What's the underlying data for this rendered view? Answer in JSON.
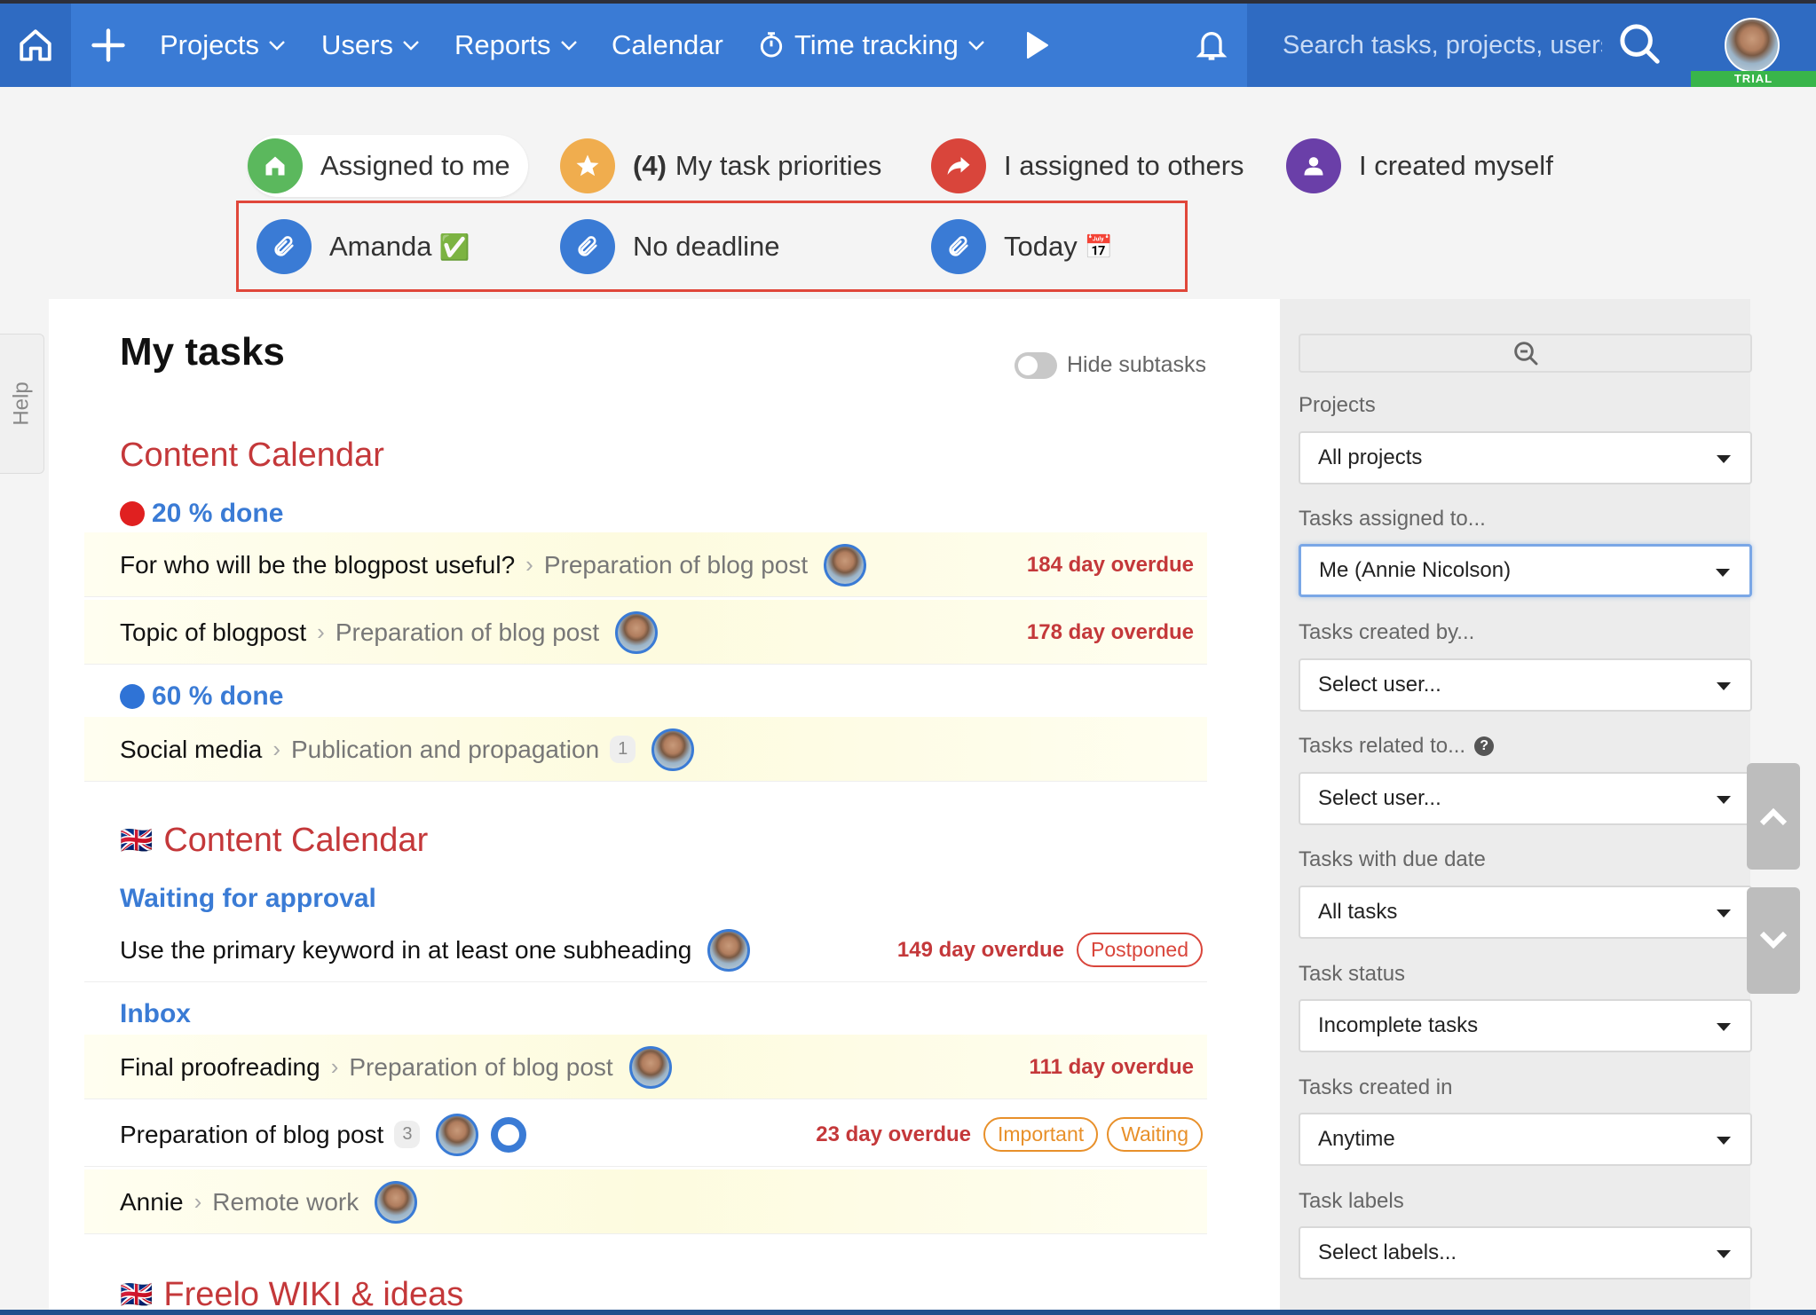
{
  "nav": {
    "projects": "Projects",
    "users": "Users",
    "reports": "Reports",
    "calendar": "Calendar",
    "time_tracking": "Time tracking",
    "search_placeholder": "Search tasks, projects, users",
    "trial": "TRIAL"
  },
  "filters": {
    "assigned_to_me": "Assigned to me",
    "priorities_count": "(4)",
    "priorities": "My task priorities",
    "assigned_to_others": "I assigned to others",
    "created_myself": "I created myself"
  },
  "saved_filters": [
    {
      "label": "Amanda",
      "emoji": "✅"
    },
    {
      "label": "No deadline",
      "emoji": ""
    },
    {
      "label": "Today",
      "emoji": "📅"
    }
  ],
  "help": "Help",
  "main": {
    "title": "My tasks",
    "hide_subtasks": "Hide subtasks",
    "projects": [
      {
        "name": "Content Calendar",
        "lists": [
          {
            "name": "20 % done",
            "dot": "#e02020",
            "tasks": [
              {
                "name": "For who will be the blogpost useful?",
                "parent": "Preparation of blog post",
                "overdue": "184 day overdue"
              },
              {
                "name": "Topic of blogpost",
                "parent": "Preparation of blog post",
                "overdue": "178 day overdue"
              }
            ]
          },
          {
            "name": "60 % done",
            "dot": "#2f73d6",
            "tasks": [
              {
                "name": "Social media",
                "parent": "Publication and propagation",
                "count": "1"
              }
            ]
          }
        ]
      },
      {
        "name": "Content Calendar",
        "flag": "🇬🇧",
        "lists": [
          {
            "name": "Waiting for approval",
            "tasks": [
              {
                "name": "Use the primary keyword in at least one subheading",
                "overdue": "149 day overdue",
                "label": "Postponed"
              }
            ]
          },
          {
            "name": "Inbox",
            "tasks": [
              {
                "name": "Final proofreading",
                "parent": "Preparation of blog post",
                "overdue": "111 day overdue"
              },
              {
                "name": "Preparation of blog post",
                "count": "3",
                "overdue": "23 day overdue",
                "labels": [
                  "Important",
                  "Waiting"
                ]
              },
              {
                "name": "Annie",
                "parent": "Remote work"
              }
            ]
          }
        ]
      },
      {
        "name": "Freelo WIKI & ideas",
        "flag": "🇬🇧"
      }
    ]
  },
  "sidebar": {
    "projects_label": "Projects",
    "projects_value": "All projects",
    "assigned_label": "Tasks assigned to...",
    "assigned_value": "Me (Annie Nicolson)",
    "created_by_label": "Tasks created by...",
    "created_by_value": "Select user...",
    "related_label": "Tasks related to...",
    "related_value": "Select user...",
    "due_label": "Tasks with due date",
    "due_value": "All tasks",
    "status_label": "Task status",
    "status_value": "Incomplete tasks",
    "created_in_label": "Tasks created in",
    "created_in_value": "Anytime",
    "labels_label": "Task labels",
    "labels_value": "Select labels..."
  },
  "colors": {
    "nav_blue": "#3a7bd5",
    "project_red": "#c4383a",
    "link_blue": "#3a7bd5",
    "overdue_red": "#c4383a",
    "highlight_box": "#e0473a"
  }
}
